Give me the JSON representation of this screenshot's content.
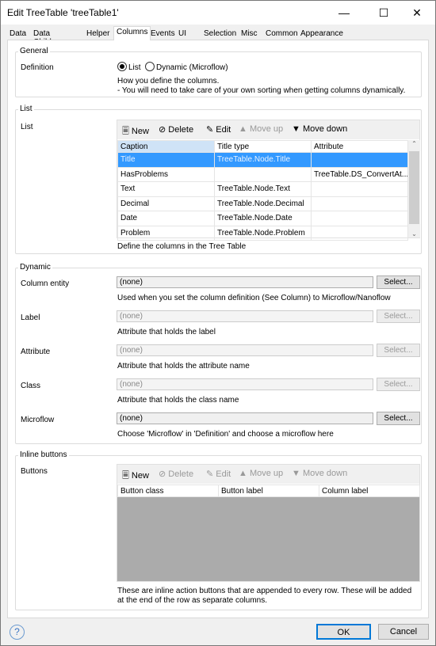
{
  "window": {
    "title": "Edit TreeTable 'treeTable1'",
    "minimize_icon": "minimize-icon",
    "maximize_icon": "maximize-icon",
    "close_icon": "close-icon"
  },
  "tabs": [
    {
      "label": "Data"
    },
    {
      "label": "Data Children"
    },
    {
      "label": "Helper"
    },
    {
      "label": "Columns",
      "active": true
    },
    {
      "label": "Events"
    },
    {
      "label": "UI"
    },
    {
      "label": "Selection"
    },
    {
      "label": "Misc"
    },
    {
      "label": "Common"
    },
    {
      "label": "Appearance"
    }
  ],
  "general": {
    "legend": "General",
    "definition_label": "Definition",
    "option_list": "List",
    "option_dynamic": "Dynamic (Microflow)",
    "selected": "List",
    "desc1": "How you define the columns.",
    "desc2": "- You will need to take care of your own sorting when getting columns dynamically."
  },
  "list": {
    "legend": "List",
    "label": "List",
    "toolbar": {
      "new": "New",
      "delete": "Delete",
      "edit": "Edit",
      "move_up": "Move up",
      "move_down": "Move down"
    },
    "columns": [
      "Caption",
      "Title type",
      "Attribute"
    ],
    "rows": [
      [
        "Title",
        "TreeTable.Node.Title",
        ""
      ],
      [
        "HasProblems",
        "",
        "TreeTable.DS_ConvertAt..."
      ],
      [
        "Text",
        "TreeTable.Node.Text",
        ""
      ],
      [
        "Decimal",
        "TreeTable.Node.Decimal",
        ""
      ],
      [
        "Date",
        "TreeTable.Node.Date",
        ""
      ],
      [
        "Problem",
        "TreeTable.Node.Problem",
        ""
      ]
    ],
    "selected_row": 0,
    "desc": "Define the columns in the Tree Table"
  },
  "dynamic": {
    "legend": "Dynamic",
    "select_label": "Select...",
    "fields": [
      {
        "label": "Column entity",
        "value": "(none)",
        "desc": "Used when you set the column definition (See Column) to Microflow/Nanoflow",
        "enabled": true
      },
      {
        "label": "Label",
        "value": "(none)",
        "desc": "Attribute that holds the label",
        "enabled": false
      },
      {
        "label": "Attribute",
        "value": "(none)",
        "desc": "Attribute that holds the attribute name",
        "enabled": false
      },
      {
        "label": "Class",
        "value": "(none)",
        "desc": "Attribute that holds the class name",
        "enabled": false
      },
      {
        "label": "Microflow",
        "value": "(none)",
        "desc": "Choose 'Microflow' in 'Definition' and choose a microflow here",
        "enabled": true
      }
    ]
  },
  "inline": {
    "legend": "Inline buttons",
    "label": "Buttons",
    "toolbar": {
      "new": "New",
      "delete": "Delete",
      "edit": "Edit",
      "move_up": "Move up",
      "move_down": "Move down"
    },
    "columns": [
      "Button class",
      "Button label",
      "Column label"
    ],
    "desc1": "These are inline action buttons that are appended to every row. These will be added",
    "desc2": "at the end of the row as separate columns."
  },
  "footer": {
    "help_icon": "help-icon",
    "ok": "OK",
    "cancel": "Cancel"
  }
}
